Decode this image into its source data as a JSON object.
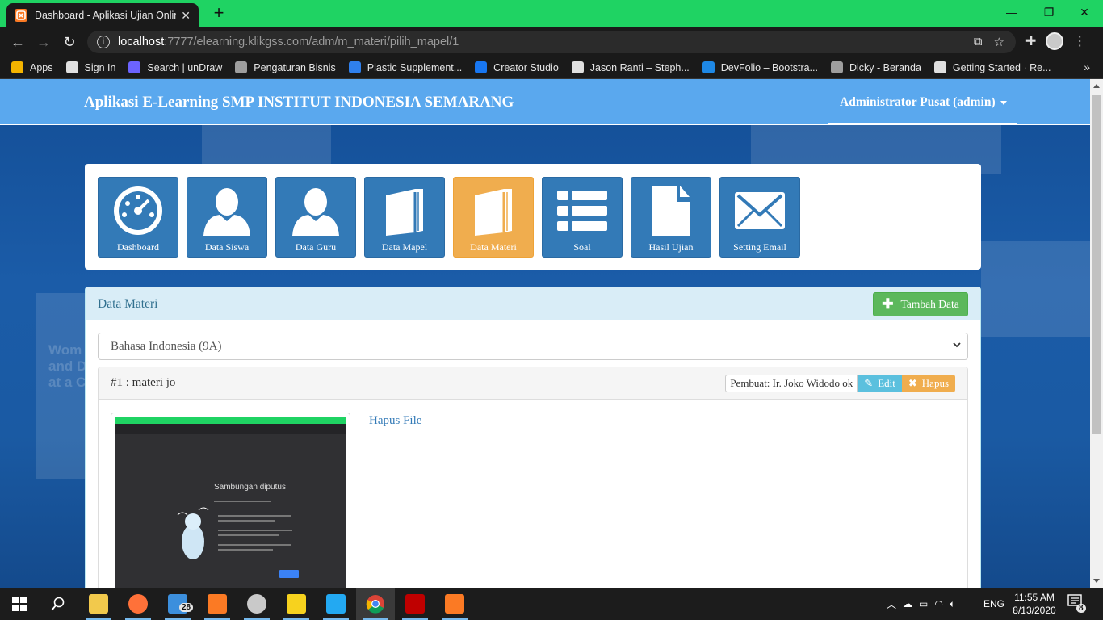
{
  "browser": {
    "tab_title": "Dashboard - Aplikasi Ujian Online",
    "url_host": "localhost",
    "url_path": ":7777/elearning.klikgss.com/adm/m_materi/pilih_mapel/1",
    "bookmarks": [
      {
        "label": "Apps",
        "icon": "apps-grid-icon",
        "color": "#f4b400"
      },
      {
        "label": "Sign In",
        "icon": "globe-icon",
        "color": "#e0e0e0"
      },
      {
        "label": "Search | unDraw",
        "icon": "undraw-icon",
        "color": "#6c63ff"
      },
      {
        "label": "Pengaturan Bisnis",
        "icon": "page-icon",
        "color": "#9e9e9e"
      },
      {
        "label": "Plastic Supplement...",
        "icon": "wave-icon",
        "color": "#2f80ed"
      },
      {
        "label": "Creator Studio",
        "icon": "facebook-icon",
        "color": "#1877f2"
      },
      {
        "label": "Jason Ranti – Steph...",
        "icon": "soundcloud-icon",
        "color": "#e0e0e0"
      },
      {
        "label": "DevFolio – Bootstra...",
        "icon": "devfolio-icon",
        "color": "#1e88e5"
      },
      {
        "label": "Dicky - Beranda",
        "icon": "page-icon",
        "color": "#9e9e9e"
      },
      {
        "label": "Getting Started · Re...",
        "icon": "react-icon",
        "color": "#e0e0e0"
      }
    ]
  },
  "app": {
    "brand": "Aplikasi E-Learning SMP INSTITUT INDONESIA SEMARANG",
    "user": "Administrator Pusat (admin)"
  },
  "menu": [
    {
      "label": "Dashboard",
      "icon": "dashboard-gauge-icon",
      "active": false
    },
    {
      "label": "Data Siswa",
      "icon": "user-icon",
      "active": false
    },
    {
      "label": "Data Guru",
      "icon": "user-icon",
      "active": false
    },
    {
      "label": "Data Mapel",
      "icon": "book-icon",
      "active": false
    },
    {
      "label": "Data Materi",
      "icon": "book-icon",
      "active": true
    },
    {
      "label": "Soal",
      "icon": "list-icon",
      "active": false
    },
    {
      "label": "Hasil Ujian",
      "icon": "file-icon",
      "active": false
    },
    {
      "label": "Setting Email",
      "icon": "envelope-icon",
      "active": false
    }
  ],
  "panel": {
    "title": "Data Materi",
    "add_label": "Tambah Data",
    "select_value": "Bahasa Indonesia (9A)"
  },
  "materi": {
    "title": "#1 : materi jo",
    "author": "Pembuat: Ir. Joko Widodo ok",
    "edit_label": "Edit",
    "delete_label": "Hapus",
    "hapus_file": "Hapus File",
    "thumbnail_heading": "Sambungan diputus"
  },
  "taskbar": {
    "time": "11:55 AM",
    "date": "8/13/2020",
    "language": "ENG",
    "mail_badge": "28",
    "notif_badge": "8"
  },
  "colors": {
    "appbar": "#5aa8ee",
    "tile": "#337ab7",
    "tile_active": "#f0ad4e",
    "success": "#5cb85c",
    "info": "#5bc0de",
    "warning": "#f0ad4e",
    "chrome_tabstrip": "#1fd363"
  }
}
